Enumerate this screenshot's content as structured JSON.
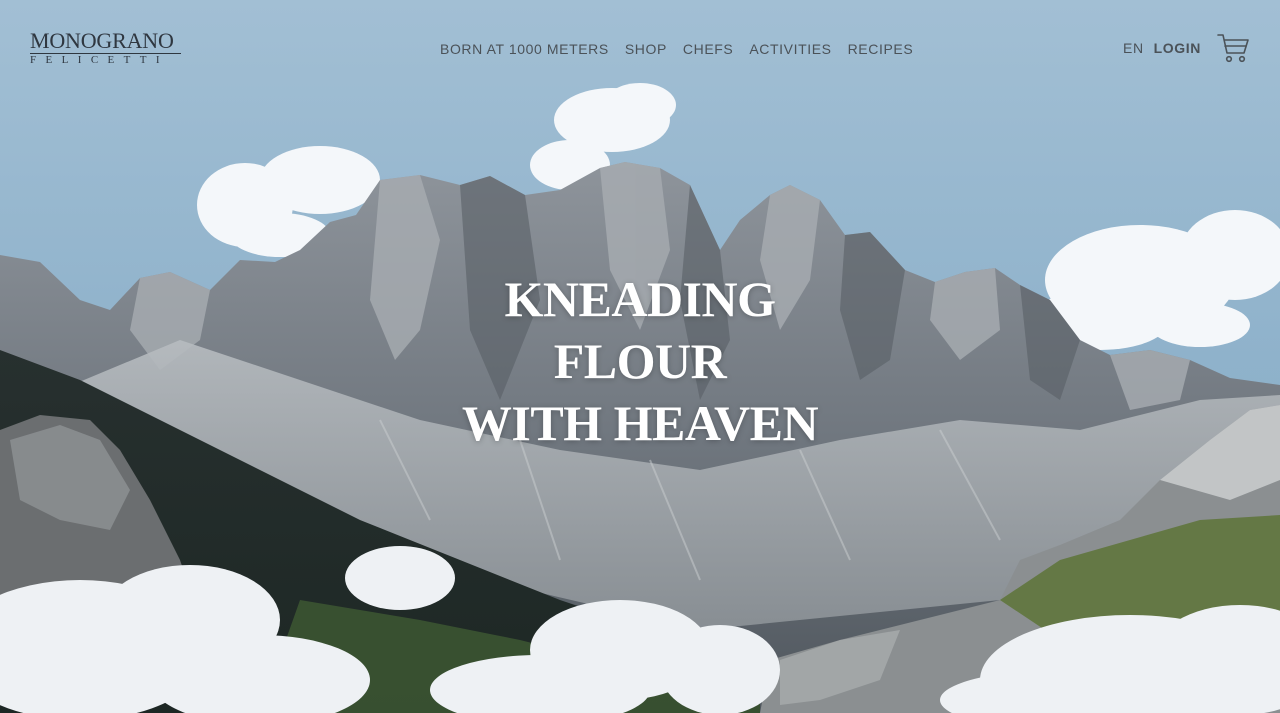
{
  "brand": {
    "name": "MONOGRANO",
    "subname": "FELICETTI"
  },
  "nav": {
    "items": [
      {
        "label": "BORN AT 1000 METERS"
      },
      {
        "label": "SHOP"
      },
      {
        "label": "CHEFS"
      },
      {
        "label": "ACTIVITIES"
      },
      {
        "label": "RECIPES"
      }
    ]
  },
  "header": {
    "language": "EN",
    "login": "LOGIN",
    "cart_icon": "cart-icon"
  },
  "hero": {
    "headline": [
      "KNEADING",
      "FLOUR",
      "WITH HEAVEN"
    ]
  },
  "colors": {
    "sky": "#9dbbd2",
    "nav_text": "#4b5258",
    "logo_text": "#2f3740",
    "headline": "#ffffff"
  }
}
